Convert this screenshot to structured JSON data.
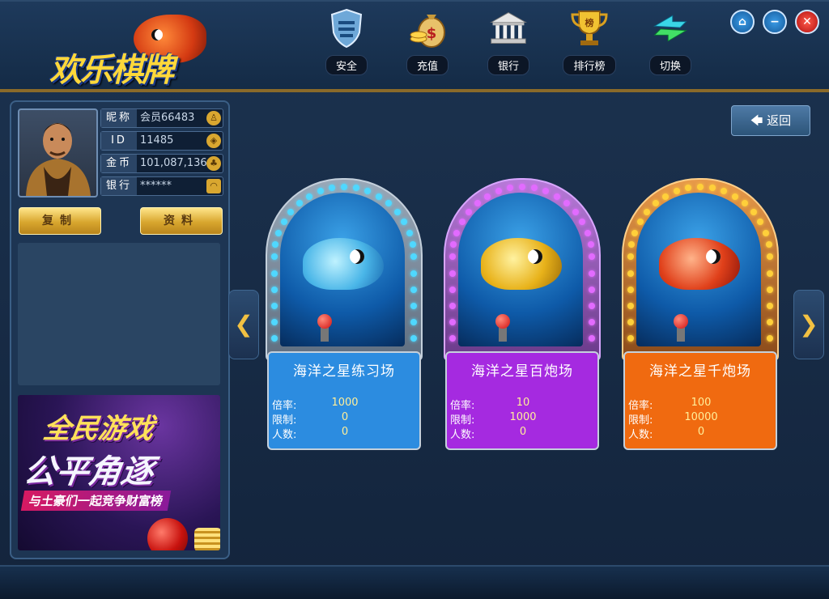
{
  "app": {
    "logo_text": "欢乐棋牌"
  },
  "nav": [
    {
      "label": "安全",
      "icon": "shield-icon"
    },
    {
      "label": "充值",
      "icon": "money-bag-icon"
    },
    {
      "label": "银行",
      "icon": "bank-icon"
    },
    {
      "label": "排行榜",
      "icon": "trophy-icon"
    },
    {
      "label": "切换",
      "icon": "switch-icon"
    }
  ],
  "window_controls": {
    "home": "⌂",
    "minimize": "−",
    "close": "✕"
  },
  "user": {
    "nickname_label": "昵称",
    "nickname": "会员66483",
    "id_label": "ID",
    "id": "11485",
    "coins_label": "金币",
    "coins": "101,087,136",
    "bank_label": "银行",
    "bank": "******"
  },
  "buttons": {
    "copy": "复制",
    "profile": "资料",
    "back": "返回",
    "prev": "❮",
    "next": "❯"
  },
  "banner": {
    "line1": "全民游戏",
    "line2": "公平角逐",
    "line3": "与土豪们一起竞争财富榜"
  },
  "rooms": [
    {
      "title": "海洋之星练习场",
      "rate_label": "倍率:",
      "rate": "1000",
      "limit_label": "限制:",
      "limit": "0",
      "players_label": "人数:",
      "players": "0",
      "theme": "#2c8ce0",
      "dots": "#4fd8ff"
    },
    {
      "title": "海洋之星百炮场",
      "rate_label": "倍率:",
      "rate": "10",
      "limit_label": "限制:",
      "limit": "1000",
      "players_label": "人数:",
      "players": "0",
      "theme": "#a52ae0",
      "dots": "#e26bff"
    },
    {
      "title": "海洋之星千炮场",
      "rate_label": "倍率:",
      "rate": "100",
      "limit_label": "限制:",
      "limit": "10000",
      "players_label": "人数:",
      "players": "0",
      "theme": "#f06a10",
      "dots": "#ffd03a"
    }
  ]
}
